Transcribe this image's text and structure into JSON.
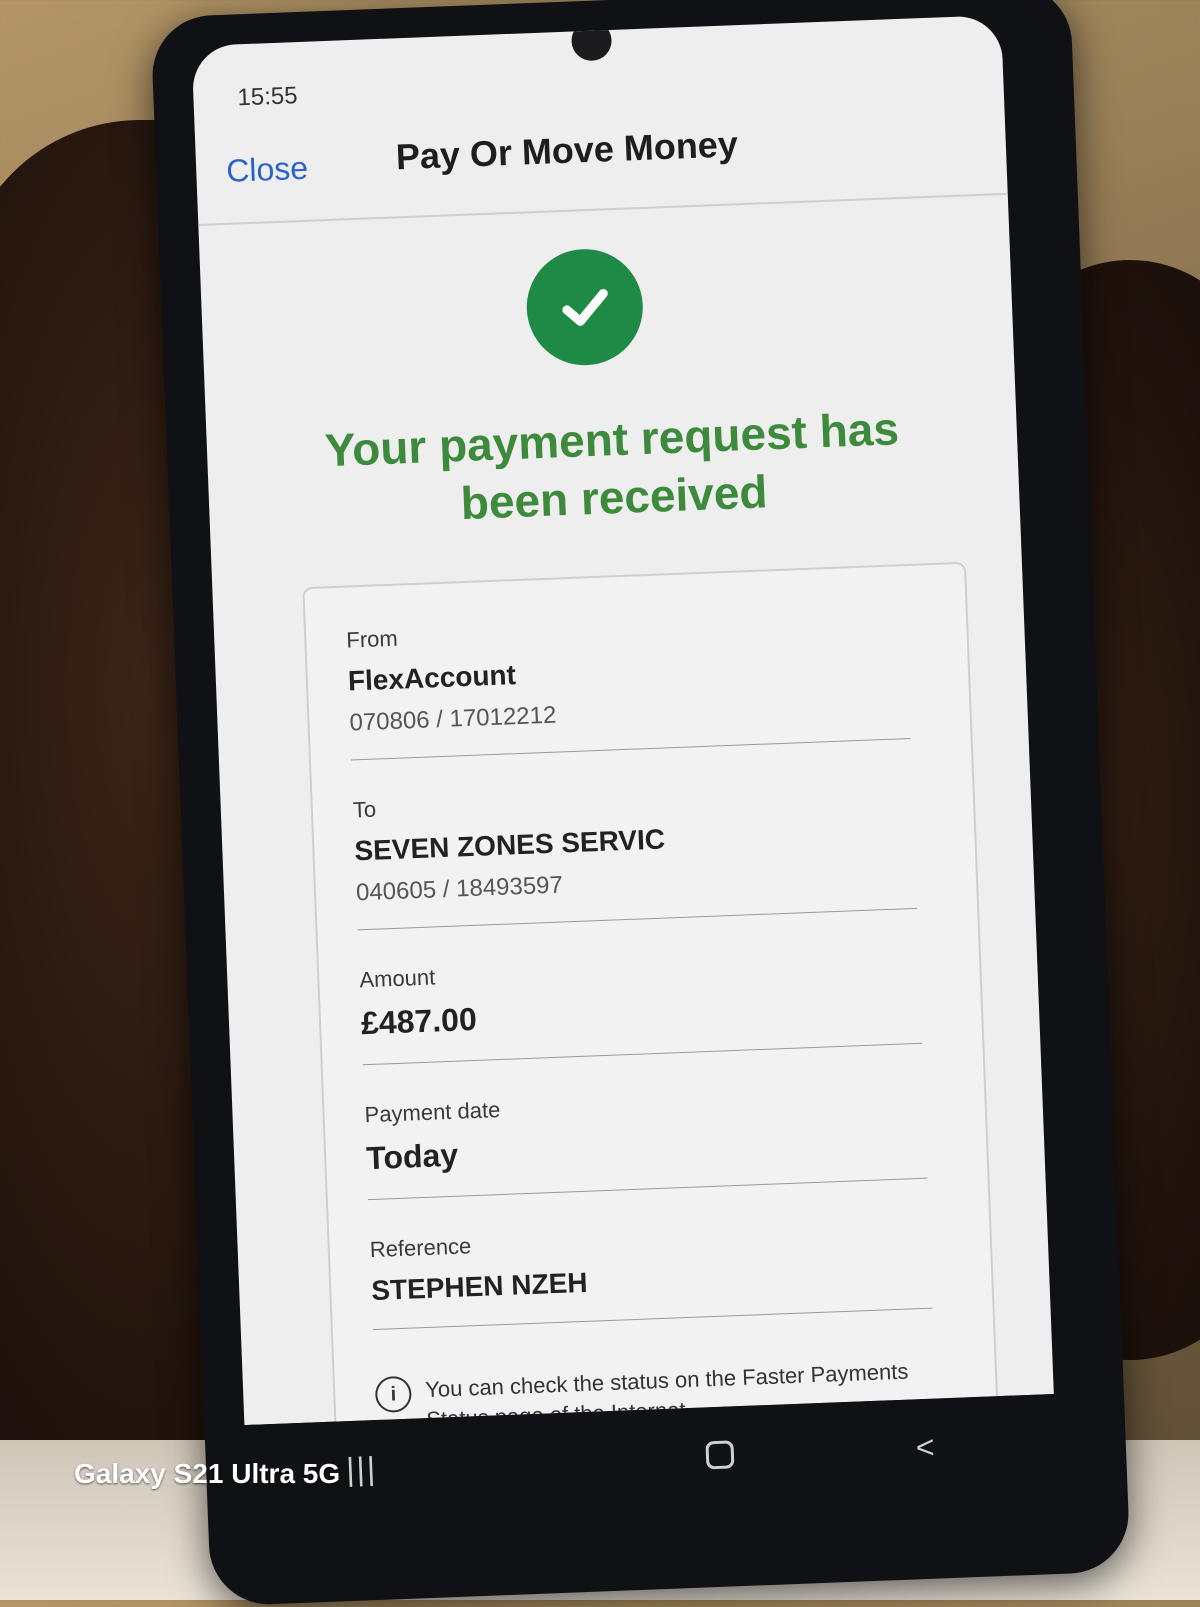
{
  "status_bar": {
    "time": "15:55"
  },
  "header": {
    "close_label": "Close",
    "title": "Pay Or Move Money"
  },
  "confirmation": {
    "headline": "Your payment request has been received",
    "icon": "check-icon",
    "icon_color": "#1f8a45"
  },
  "details": {
    "from": {
      "label": "From",
      "name": "FlexAccount",
      "account": "070806 / 17012212"
    },
    "to": {
      "label": "To",
      "name": "SEVEN ZONES SERVIC",
      "account": "040605 / 18493597"
    },
    "amount": {
      "label": "Amount",
      "value": "£487.00"
    },
    "payment_date": {
      "label": "Payment date",
      "value": "Today"
    },
    "reference": {
      "label": "Reference",
      "value": "STEPHEN NZEH"
    }
  },
  "info": {
    "text": "You can check the status on the Faster Payments Status page of the Internet"
  },
  "watermark": "Galaxy S21 Ultra 5G"
}
